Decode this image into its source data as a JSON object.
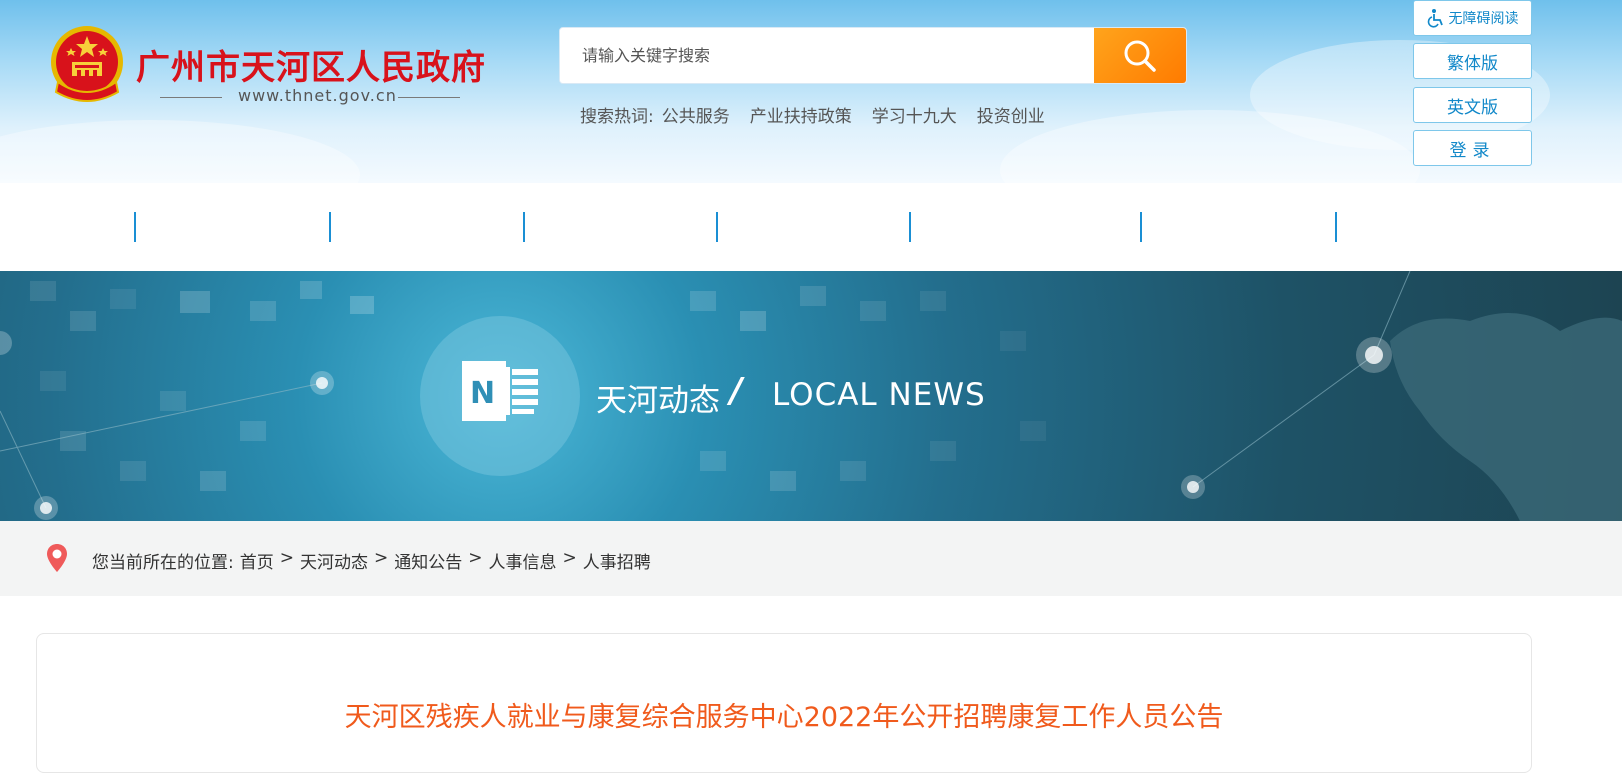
{
  "site": {
    "title": "广州市天河区人民政府",
    "url": "www.thnet.gov.cn"
  },
  "search": {
    "placeholder": "请输入关键字搜索",
    "value": "",
    "hot_label": "搜索热词:",
    "hot_words": [
      "公共服务",
      "产业扶持政策",
      "学习十九大",
      "投资创业"
    ]
  },
  "top_buttons": {
    "accessibility": "无障碍阅读",
    "traditional": "繁体版",
    "english": "英文版",
    "login": "登录"
  },
  "banner": {
    "title": "天河动态",
    "slash": "/",
    "subtitle": "LOCAL NEWS",
    "icon_letter": "N"
  },
  "breadcrumb": {
    "prefix": "您当前所在的位置:",
    "items": [
      "首页",
      "天河动态",
      "通知公告",
      "人事信息",
      "人事招聘"
    ],
    "separator": ">"
  },
  "article": {
    "title": "天河区残疾人就业与康复综合服务中心2022年公开招聘康复工作人员公告"
  },
  "colors": {
    "title_red": "#d8121b",
    "search_orange": "#ff8c0a",
    "link_blue": "#1188c9",
    "article_title": "#f05a1c"
  }
}
